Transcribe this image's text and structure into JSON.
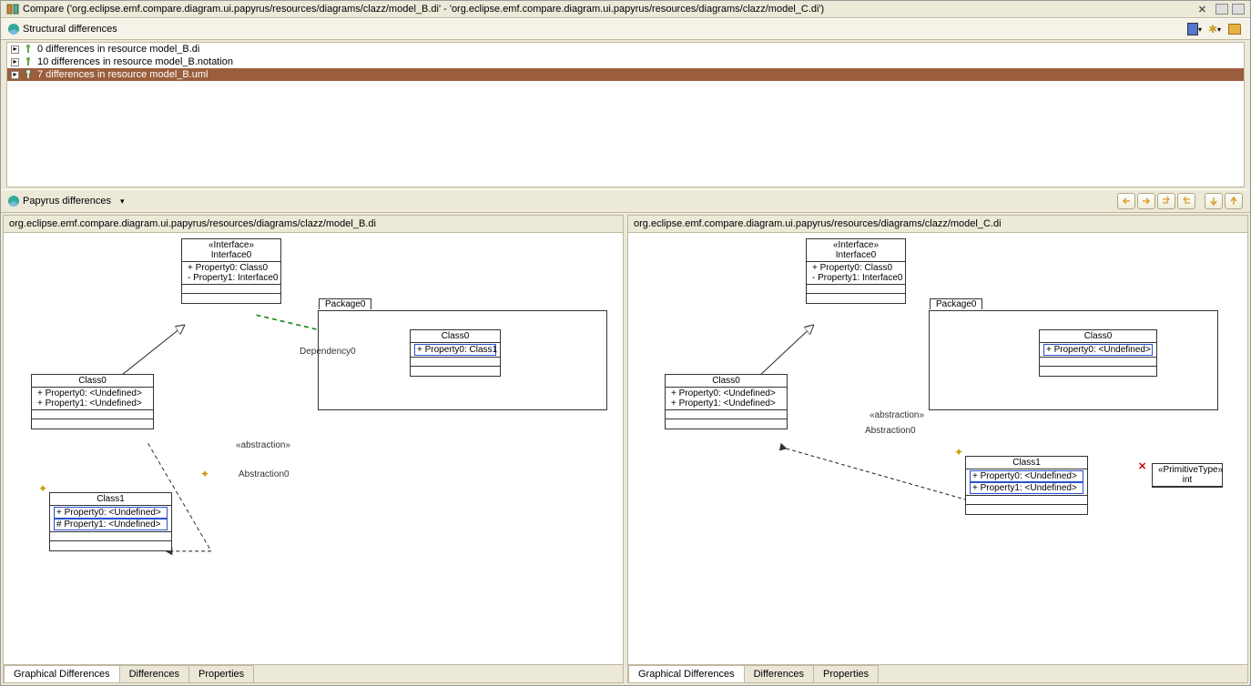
{
  "title": "Compare ('org.eclipse.emf.compare.diagram.ui.papyrus/resources/diagrams/clazz/model_B.di' - 'org.eclipse.emf.compare.diagram.ui.papyrus/resources/diagrams/clazz/model_C.di')",
  "structural_label": "Structural differences",
  "tree": [
    {
      "label": "0 differences in resource model_B.di"
    },
    {
      "label": "10 differences in resource model_B.notation"
    },
    {
      "label": "7 differences in resource model_B.uml"
    }
  ],
  "papyrus_label": "Papyrus differences",
  "left_path": "org.eclipse.emf.compare.diagram.ui.papyrus/resources/diagrams/clazz/model_B.di",
  "right_path": "org.eclipse.emf.compare.diagram.ui.papyrus/resources/diagrams/clazz/model_C.di",
  "tabs": {
    "t1": "Graphical Differences",
    "t2": "Differences",
    "t3": "Properties"
  },
  "uml": {
    "iface_stereo": "«Interface»",
    "iface_name": "Interface0",
    "iface_p0": "+ Property0: Class0",
    "iface_p1": "- Property1: Interface0",
    "class0_name": "Class0",
    "class0_p0": "+ Property0: <Undefined>",
    "class0_p1": "+ Property1: <Undefined>",
    "class1_name": "Class1",
    "class1_p0": "+ Property0: <Undefined>",
    "class1_p1_left": "# Property1: <Undefined>",
    "class1_p1_right": "+ Property1: <Undefined>",
    "pkg_name": "Package0",
    "pkg_class0": "Class0",
    "pkg_class0_p_left": "+ Property0: Class1",
    "pkg_class0_p_right": "+ Property0: <Undefined>",
    "abstr_stereo": "«abstraction»",
    "abstr_name": "Abstraction0",
    "dep_name": "Dependency0",
    "prim_stereo": "«PrimitiveType»",
    "prim_name": "int"
  }
}
